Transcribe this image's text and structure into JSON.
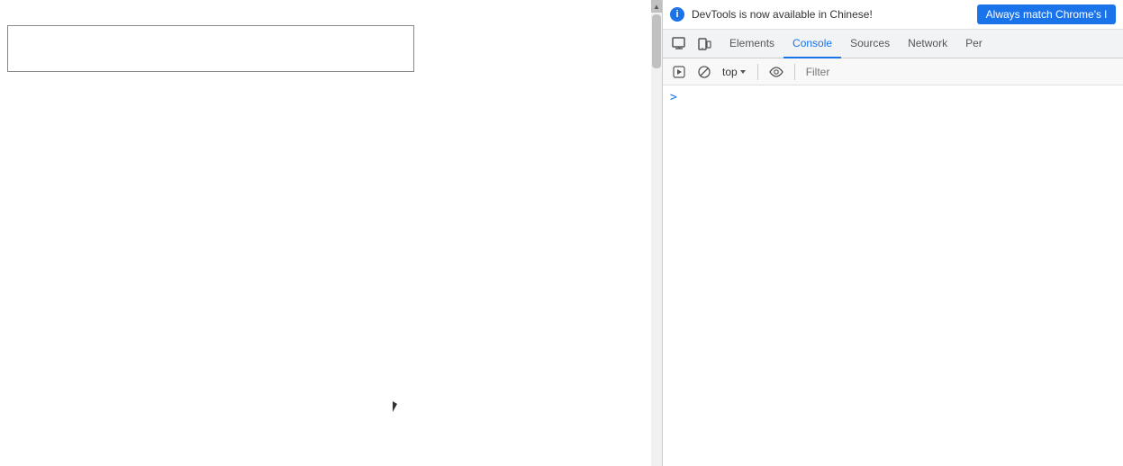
{
  "page": {
    "text_input_placeholder": ""
  },
  "devtools": {
    "notification": {
      "text": "DevTools is now available in Chinese!",
      "button_label": "Always match Chrome's l",
      "info_icon": "i"
    },
    "tabs": [
      {
        "label": "Elements",
        "active": false
      },
      {
        "label": "Console",
        "active": true
      },
      {
        "label": "Sources",
        "active": false
      },
      {
        "label": "Network",
        "active": false
      },
      {
        "label": "Per",
        "active": false
      }
    ],
    "toolbar_icons": {
      "inspect": "⬚",
      "device": "▭",
      "play": "▶",
      "block": "⊘",
      "top_label": "top",
      "eye_icon": "👁",
      "filter_placeholder": "Filter"
    },
    "console_prompt": ">"
  }
}
